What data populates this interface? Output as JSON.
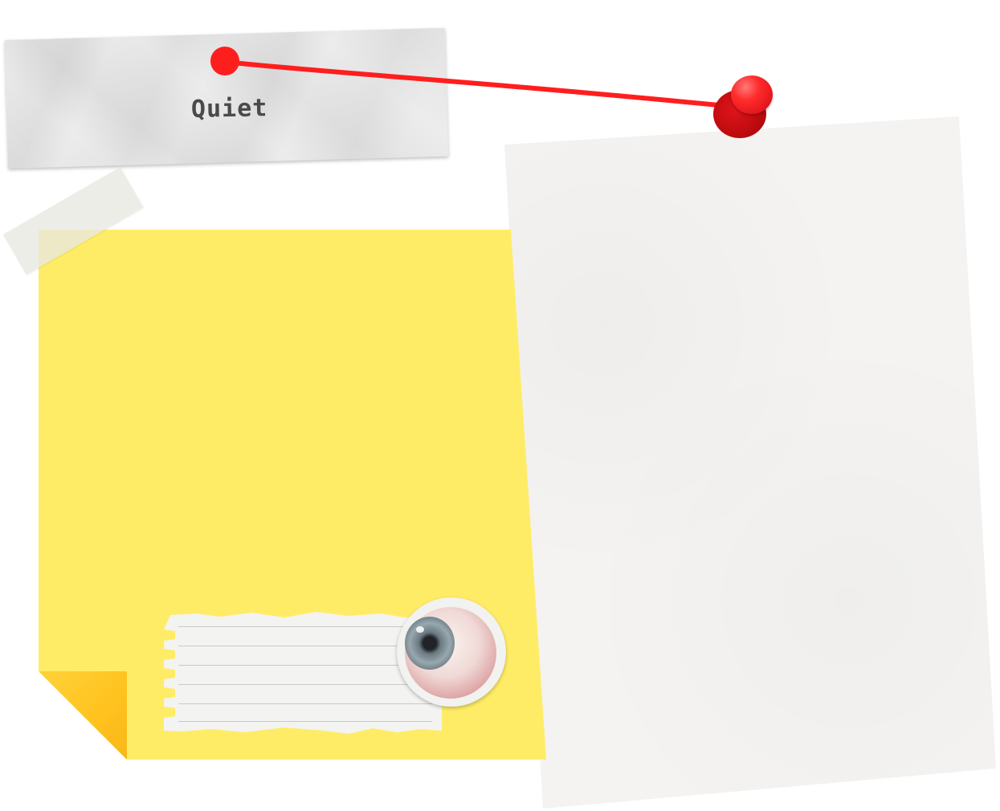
{
  "label": {
    "text": "Quiet"
  },
  "colors": {
    "string": "#ff1e1e",
    "pin": "#e0131a",
    "sticky_note": "#ffec66",
    "sticky_curl": "#ffc21e",
    "paper": "#f4f3f1"
  },
  "icons": {
    "pin": "pushpin-icon",
    "eye": "eyeball-icon"
  }
}
